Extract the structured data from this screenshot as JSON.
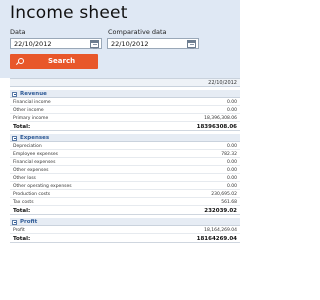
{
  "header": {
    "title": "Income sheet",
    "date_label": "Data",
    "date_value": "22/10/2012",
    "comparative_label": "Comparative data",
    "comparative_value": "22/10/2012",
    "search_label": "Search"
  },
  "table": {
    "column_date": "22/10/2012",
    "sections": [
      {
        "name": "Revenue",
        "rows": [
          {
            "label": "Financial income",
            "value": "0.00"
          },
          {
            "label": "Other income",
            "value": "0.00"
          },
          {
            "label": "Primary income",
            "value": "18,396,308.06"
          }
        ],
        "total_label": "Total:",
        "total_value": "18396308.06"
      },
      {
        "name": "Expenses",
        "rows": [
          {
            "label": "Depreciation",
            "value": "0.00"
          },
          {
            "label": "Employee expenses",
            "value": "782.32"
          },
          {
            "label": "Financial expenses",
            "value": "0.00"
          },
          {
            "label": "Other expenses",
            "value": "0.00"
          },
          {
            "label": "Other loss",
            "value": "0.00"
          },
          {
            "label": "Other operating expenses",
            "value": "0.00"
          },
          {
            "label": "Production costs",
            "value": "230,695.02"
          },
          {
            "label": "Tax costs",
            "value": "561.68"
          }
        ],
        "total_label": "Total:",
        "total_value": "232039.02"
      },
      {
        "name": "Profit",
        "rows": [
          {
            "label": "Profit",
            "value": "18,164,269.04"
          }
        ],
        "total_label": "Total:",
        "total_value": "18164269.04"
      }
    ]
  },
  "icons": {
    "search": "search-icon",
    "calendar": "calendar-icon",
    "collapse": "collapse-toggle-icon"
  },
  "colors": {
    "panel": "#dfe8f4",
    "accent": "#e8572a",
    "section_text": "#2e5a96"
  }
}
